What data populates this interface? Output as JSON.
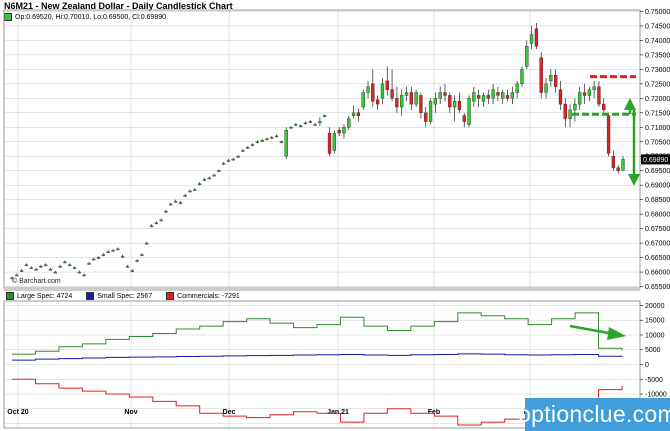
{
  "title": "N6M21 - New Zealand Dollar - Daily Candlestick Chart",
  "ohlc": "Op:0.69520, Hi:0.70010, Lo:0.69500, Cl:0.69890",
  "watermark": "© Barchart.com",
  "logo": "optionclue.com",
  "colors": {
    "up": "#33cc33",
    "down": "#dd2222",
    "large": "#2e8b2e",
    "small": "#1a1aa8",
    "comm": "#e02020",
    "arrow": "#2aa52a",
    "grid": "#c8c8c8"
  },
  "chart_data": [
    {
      "type": "candlestick",
      "ylim": [
        0.6545,
        0.7505
      ],
      "yticks": [
        "0.75000",
        "0.74500",
        "0.74000",
        "0.73500",
        "0.73000",
        "0.72500",
        "0.72000",
        "0.71500",
        "0.71000",
        "0.70500",
        "0.70000",
        "0.69500",
        "0.69000",
        "0.68500",
        "0.68000",
        "0.67500",
        "0.67000",
        "0.66500",
        "0.66000",
        "0.65500"
      ],
      "last_value": "0.69890",
      "xticks": [
        "Oct 20",
        "Nov",
        "Dec",
        "Jan 21",
        "Feb",
        "Mar"
      ],
      "candles": [
        {
          "o": 0.658,
          "h": 0.6585,
          "l": 0.6575,
          "c": 0.658
        },
        {
          "o": 0.659,
          "h": 0.6595,
          "l": 0.6585,
          "c": 0.659
        },
        {
          "o": 0.6605,
          "h": 0.661,
          "l": 0.66,
          "c": 0.6605
        },
        {
          "o": 0.6625,
          "h": 0.663,
          "l": 0.662,
          "c": 0.6625
        },
        {
          "o": 0.6615,
          "h": 0.662,
          "l": 0.661,
          "c": 0.6615
        },
        {
          "o": 0.661,
          "h": 0.6615,
          "l": 0.6605,
          "c": 0.661
        },
        {
          "o": 0.662,
          "h": 0.6625,
          "l": 0.6615,
          "c": 0.662
        },
        {
          "o": 0.6625,
          "h": 0.663,
          "l": 0.662,
          "c": 0.6625
        },
        {
          "o": 0.661,
          "h": 0.6615,
          "l": 0.6605,
          "c": 0.661
        },
        {
          "o": 0.66,
          "h": 0.6605,
          "l": 0.6595,
          "c": 0.66
        },
        {
          "o": 0.662,
          "h": 0.6625,
          "l": 0.6615,
          "c": 0.662
        },
        {
          "o": 0.6635,
          "h": 0.664,
          "l": 0.663,
          "c": 0.6635
        },
        {
          "o": 0.6625,
          "h": 0.663,
          "l": 0.662,
          "c": 0.6625
        },
        {
          "o": 0.6615,
          "h": 0.662,
          "l": 0.661,
          "c": 0.6615
        },
        {
          "o": 0.66,
          "h": 0.6605,
          "l": 0.6595,
          "c": 0.66
        },
        {
          "o": 0.659,
          "h": 0.6595,
          "l": 0.6585,
          "c": 0.659
        },
        {
          "o": 0.663,
          "h": 0.6635,
          "l": 0.6625,
          "c": 0.663
        },
        {
          "o": 0.6645,
          "h": 0.665,
          "l": 0.664,
          "c": 0.6645
        },
        {
          "o": 0.665,
          "h": 0.6655,
          "l": 0.6645,
          "c": 0.665
        },
        {
          "o": 0.666,
          "h": 0.6665,
          "l": 0.6655,
          "c": 0.666
        },
        {
          "o": 0.667,
          "h": 0.6675,
          "l": 0.6665,
          "c": 0.667
        },
        {
          "o": 0.6675,
          "h": 0.668,
          "l": 0.667,
          "c": 0.6675
        },
        {
          "o": 0.668,
          "h": 0.6685,
          "l": 0.6675,
          "c": 0.668
        },
        {
          "o": 0.6655,
          "h": 0.666,
          "l": 0.665,
          "c": 0.6655
        },
        {
          "o": 0.662,
          "h": 0.6625,
          "l": 0.6615,
          "c": 0.662
        },
        {
          "o": 0.6605,
          "h": 0.661,
          "l": 0.66,
          "c": 0.6605
        },
        {
          "o": 0.664,
          "h": 0.6645,
          "l": 0.6635,
          "c": 0.664
        },
        {
          "o": 0.666,
          "h": 0.6665,
          "l": 0.6655,
          "c": 0.666
        },
        {
          "o": 0.67,
          "h": 0.6705,
          "l": 0.6695,
          "c": 0.67
        },
        {
          "o": 0.676,
          "h": 0.6765,
          "l": 0.6755,
          "c": 0.676
        },
        {
          "o": 0.677,
          "h": 0.6775,
          "l": 0.6765,
          "c": 0.677
        },
        {
          "o": 0.678,
          "h": 0.6785,
          "l": 0.6775,
          "c": 0.678
        },
        {
          "o": 0.681,
          "h": 0.6815,
          "l": 0.6805,
          "c": 0.681
        },
        {
          "o": 0.6835,
          "h": 0.684,
          "l": 0.683,
          "c": 0.6835
        },
        {
          "o": 0.6845,
          "h": 0.685,
          "l": 0.684,
          "c": 0.6845
        },
        {
          "o": 0.684,
          "h": 0.6845,
          "l": 0.6835,
          "c": 0.684
        },
        {
          "o": 0.6865,
          "h": 0.687,
          "l": 0.686,
          "c": 0.6865
        },
        {
          "o": 0.688,
          "h": 0.6885,
          "l": 0.6875,
          "c": 0.688
        },
        {
          "o": 0.6885,
          "h": 0.689,
          "l": 0.688,
          "c": 0.6885
        },
        {
          "o": 0.6905,
          "h": 0.691,
          "l": 0.69,
          "c": 0.6905
        },
        {
          "o": 0.692,
          "h": 0.6925,
          "l": 0.6915,
          "c": 0.692
        },
        {
          "o": 0.6925,
          "h": 0.693,
          "l": 0.692,
          "c": 0.6925
        },
        {
          "o": 0.6935,
          "h": 0.694,
          "l": 0.693,
          "c": 0.6935
        },
        {
          "o": 0.695,
          "h": 0.6955,
          "l": 0.6945,
          "c": 0.695
        },
        {
          "o": 0.6975,
          "h": 0.698,
          "l": 0.697,
          "c": 0.6975
        },
        {
          "o": 0.6985,
          "h": 0.699,
          "l": 0.698,
          "c": 0.6985
        },
        {
          "o": 0.699,
          "h": 0.6995,
          "l": 0.6985,
          "c": 0.699
        },
        {
          "o": 0.7,
          "h": 0.7005,
          "l": 0.6995,
          "c": 0.7
        },
        {
          "o": 0.702,
          "h": 0.7025,
          "l": 0.7015,
          "c": 0.702
        },
        {
          "o": 0.703,
          "h": 0.7035,
          "l": 0.7025,
          "c": 0.703
        },
        {
          "o": 0.704,
          "h": 0.7045,
          "l": 0.7035,
          "c": 0.704
        },
        {
          "o": 0.705,
          "h": 0.7055,
          "l": 0.7045,
          "c": 0.705
        },
        {
          "o": 0.7055,
          "h": 0.706,
          "l": 0.705,
          "c": 0.7055
        },
        {
          "o": 0.706,
          "h": 0.7065,
          "l": 0.7055,
          "c": 0.706
        },
        {
          "o": 0.7065,
          "h": 0.707,
          "l": 0.706,
          "c": 0.7065
        },
        {
          "o": 0.707,
          "h": 0.7075,
          "l": 0.7065,
          "c": 0.707
        },
        {
          "o": 0.705,
          "h": 0.7055,
          "l": 0.7045,
          "c": 0.705
        },
        {
          "o": 0.7,
          "h": 0.71,
          "l": 0.699,
          "c": 0.709
        },
        {
          "o": 0.71,
          "h": 0.7105,
          "l": 0.7095,
          "c": 0.71
        },
        {
          "o": 0.711,
          "h": 0.7115,
          "l": 0.7105,
          "c": 0.711
        },
        {
          "o": 0.7105,
          "h": 0.711,
          "l": 0.71,
          "c": 0.7105
        },
        {
          "o": 0.7115,
          "h": 0.712,
          "l": 0.711,
          "c": 0.7115
        },
        {
          "o": 0.712,
          "h": 0.7125,
          "l": 0.7115,
          "c": 0.712
        },
        {
          "o": 0.711,
          "h": 0.7115,
          "l": 0.7105,
          "c": 0.711
        },
        {
          "o": 0.7115,
          "h": 0.7135,
          "l": 0.7105,
          "c": 0.712
        },
        {
          "o": 0.714,
          "h": 0.7145,
          "l": 0.7135,
          "c": 0.714
        },
        {
          "o": 0.708,
          "h": 0.71,
          "l": 0.7,
          "c": 0.701
        },
        {
          "o": 0.702,
          "h": 0.709,
          "l": 0.701,
          "c": 0.708
        },
        {
          "o": 0.709,
          "h": 0.71,
          "l": 0.707,
          "c": 0.708
        },
        {
          "o": 0.708,
          "h": 0.711,
          "l": 0.706,
          "c": 0.71
        },
        {
          "o": 0.71,
          "h": 0.714,
          "l": 0.709,
          "c": 0.713
        },
        {
          "o": 0.714,
          "h": 0.7175,
          "l": 0.713,
          "c": 0.715
        },
        {
          "o": 0.715,
          "h": 0.7165,
          "l": 0.712,
          "c": 0.714
        },
        {
          "o": 0.717,
          "h": 0.723,
          "l": 0.716,
          "c": 0.722
        },
        {
          "o": 0.722,
          "h": 0.726,
          "l": 0.72,
          "c": 0.724
        },
        {
          "o": 0.725,
          "h": 0.73,
          "l": 0.717,
          "c": 0.719
        },
        {
          "o": 0.7195,
          "h": 0.721,
          "l": 0.716,
          "c": 0.718
        },
        {
          "o": 0.72,
          "h": 0.727,
          "l": 0.718,
          "c": 0.725
        },
        {
          "o": 0.726,
          "h": 0.731,
          "l": 0.721,
          "c": 0.723
        },
        {
          "o": 0.723,
          "h": 0.73,
          "l": 0.719,
          "c": 0.72
        },
        {
          "o": 0.72,
          "h": 0.724,
          "l": 0.715,
          "c": 0.717
        },
        {
          "o": 0.717,
          "h": 0.723,
          "l": 0.714,
          "c": 0.721
        },
        {
          "o": 0.721,
          "h": 0.724,
          "l": 0.719,
          "c": 0.722
        },
        {
          "o": 0.722,
          "h": 0.724,
          "l": 0.716,
          "c": 0.718
        },
        {
          "o": 0.718,
          "h": 0.723,
          "l": 0.717,
          "c": 0.722
        },
        {
          "o": 0.721,
          "h": 0.722,
          "l": 0.713,
          "c": 0.715
        },
        {
          "o": 0.715,
          "h": 0.717,
          "l": 0.71,
          "c": 0.712
        },
        {
          "o": 0.712,
          "h": 0.72,
          "l": 0.711,
          "c": 0.719
        },
        {
          "o": 0.718,
          "h": 0.722,
          "l": 0.715,
          "c": 0.72
        },
        {
          "o": 0.72,
          "h": 0.724,
          "l": 0.718,
          "c": 0.722
        },
        {
          "o": 0.722,
          "h": 0.725,
          "l": 0.719,
          "c": 0.721
        },
        {
          "o": 0.721,
          "h": 0.722,
          "l": 0.715,
          "c": 0.717
        },
        {
          "o": 0.717,
          "h": 0.721,
          "l": 0.712,
          "c": 0.719
        },
        {
          "o": 0.719,
          "h": 0.722,
          "l": 0.715,
          "c": 0.716
        },
        {
          "o": 0.714,
          "h": 0.715,
          "l": 0.71,
          "c": 0.712
        },
        {
          "o": 0.711,
          "h": 0.721,
          "l": 0.71,
          "c": 0.72
        },
        {
          "o": 0.719,
          "h": 0.724,
          "l": 0.717,
          "c": 0.722
        },
        {
          "o": 0.721,
          "h": 0.723,
          "l": 0.717,
          "c": 0.72
        },
        {
          "o": 0.719,
          "h": 0.722,
          "l": 0.717,
          "c": 0.721
        },
        {
          "o": 0.721,
          "h": 0.723,
          "l": 0.718,
          "c": 0.72
        },
        {
          "o": 0.72,
          "h": 0.725,
          "l": 0.718,
          "c": 0.723
        },
        {
          "o": 0.722,
          "h": 0.724,
          "l": 0.719,
          "c": 0.721
        },
        {
          "o": 0.72,
          "h": 0.723,
          "l": 0.718,
          "c": 0.722
        },
        {
          "o": 0.721,
          "h": 0.723,
          "l": 0.719,
          "c": 0.72
        },
        {
          "o": 0.72,
          "h": 0.724,
          "l": 0.718,
          "c": 0.722
        },
        {
          "o": 0.722,
          "h": 0.726,
          "l": 0.72,
          "c": 0.725
        },
        {
          "o": 0.725,
          "h": 0.731,
          "l": 0.724,
          "c": 0.73
        },
        {
          "o": 0.731,
          "h": 0.74,
          "l": 0.73,
          "c": 0.738
        },
        {
          "o": 0.739,
          "h": 0.745,
          "l": 0.737,
          "c": 0.742
        },
        {
          "o": 0.744,
          "h": 0.746,
          "l": 0.737,
          "c": 0.738
        },
        {
          "o": 0.734,
          "h": 0.736,
          "l": 0.72,
          "c": 0.722
        },
        {
          "o": 0.722,
          "h": 0.727,
          "l": 0.72,
          "c": 0.725
        },
        {
          "o": 0.726,
          "h": 0.73,
          "l": 0.724,
          "c": 0.728
        },
        {
          "o": 0.728,
          "h": 0.73,
          "l": 0.722,
          "c": 0.724
        },
        {
          "o": 0.723,
          "h": 0.726,
          "l": 0.716,
          "c": 0.718
        },
        {
          "o": 0.718,
          "h": 0.72,
          "l": 0.71,
          "c": 0.713
        },
        {
          "o": 0.713,
          "h": 0.718,
          "l": 0.71,
          "c": 0.716
        },
        {
          "o": 0.716,
          "h": 0.72,
          "l": 0.712,
          "c": 0.718
        },
        {
          "o": 0.718,
          "h": 0.724,
          "l": 0.716,
          "c": 0.722
        },
        {
          "o": 0.722,
          "h": 0.725,
          "l": 0.718,
          "c": 0.721
        },
        {
          "o": 0.721,
          "h": 0.724,
          "l": 0.719,
          "c": 0.723
        },
        {
          "o": 0.723,
          "h": 0.726,
          "l": 0.72,
          "c": 0.724
        },
        {
          "o": 0.724,
          "h": 0.726,
          "l": 0.717,
          "c": 0.718
        },
        {
          "o": 0.718,
          "h": 0.72,
          "l": 0.715,
          "c": 0.716
        },
        {
          "o": 0.714,
          "h": 0.715,
          "l": 0.7,
          "c": 0.701
        },
        {
          "o": 0.7,
          "h": 0.702,
          "l": 0.695,
          "c": 0.696
        },
        {
          "o": 0.696,
          "h": 0.697,
          "l": 0.694,
          "c": 0.695
        },
        {
          "o": 0.6952,
          "h": 0.7001,
          "l": 0.695,
          "c": 0.6989
        }
      ],
      "annotations": {
        "resistance": 0.7275,
        "support": 0.7145
      }
    },
    {
      "type": "step-line",
      "title": "COT",
      "ylim": [
        -21500,
        21500
      ],
      "yticks": [
        "20000",
        "15000",
        "10000",
        "5000",
        "0",
        "-5000",
        "-10000",
        "-15000",
        "-20000"
      ],
      "series": [
        {
          "name": "Large Spec: 4724",
          "values": [
            3500,
            4500,
            6000,
            7000,
            8500,
            9500,
            10500,
            12000,
            13000,
            14500,
            15500,
            14000,
            12500,
            13500,
            16000,
            13000,
            11500,
            13000,
            14500,
            17500,
            16500,
            15500,
            13500,
            15500,
            17500,
            5500,
            4724
          ]
        },
        {
          "name": "Small Spec: 2567",
          "values": [
            1500,
            1800,
            2000,
            2200,
            2400,
            2500,
            2600,
            2700,
            2800,
            2900,
            3000,
            3100,
            3200,
            3300,
            3400,
            3200,
            3100,
            3300,
            3400,
            3600,
            3500,
            3300,
            3200,
            3300,
            3400,
            2800,
            2567
          ]
        },
        {
          "name": "Commercials: -7291",
          "values": [
            -5000,
            -6500,
            -8000,
            -9000,
            -10000,
            -11000,
            -12500,
            -14000,
            -16500,
            -17500,
            -18000,
            -17000,
            -16000,
            -16500,
            -19500,
            -16500,
            -15000,
            -16500,
            -17500,
            -20500,
            -19500,
            -18500,
            -17000,
            -18500,
            -20500,
            -8500,
            -7291
          ]
        }
      ]
    }
  ]
}
